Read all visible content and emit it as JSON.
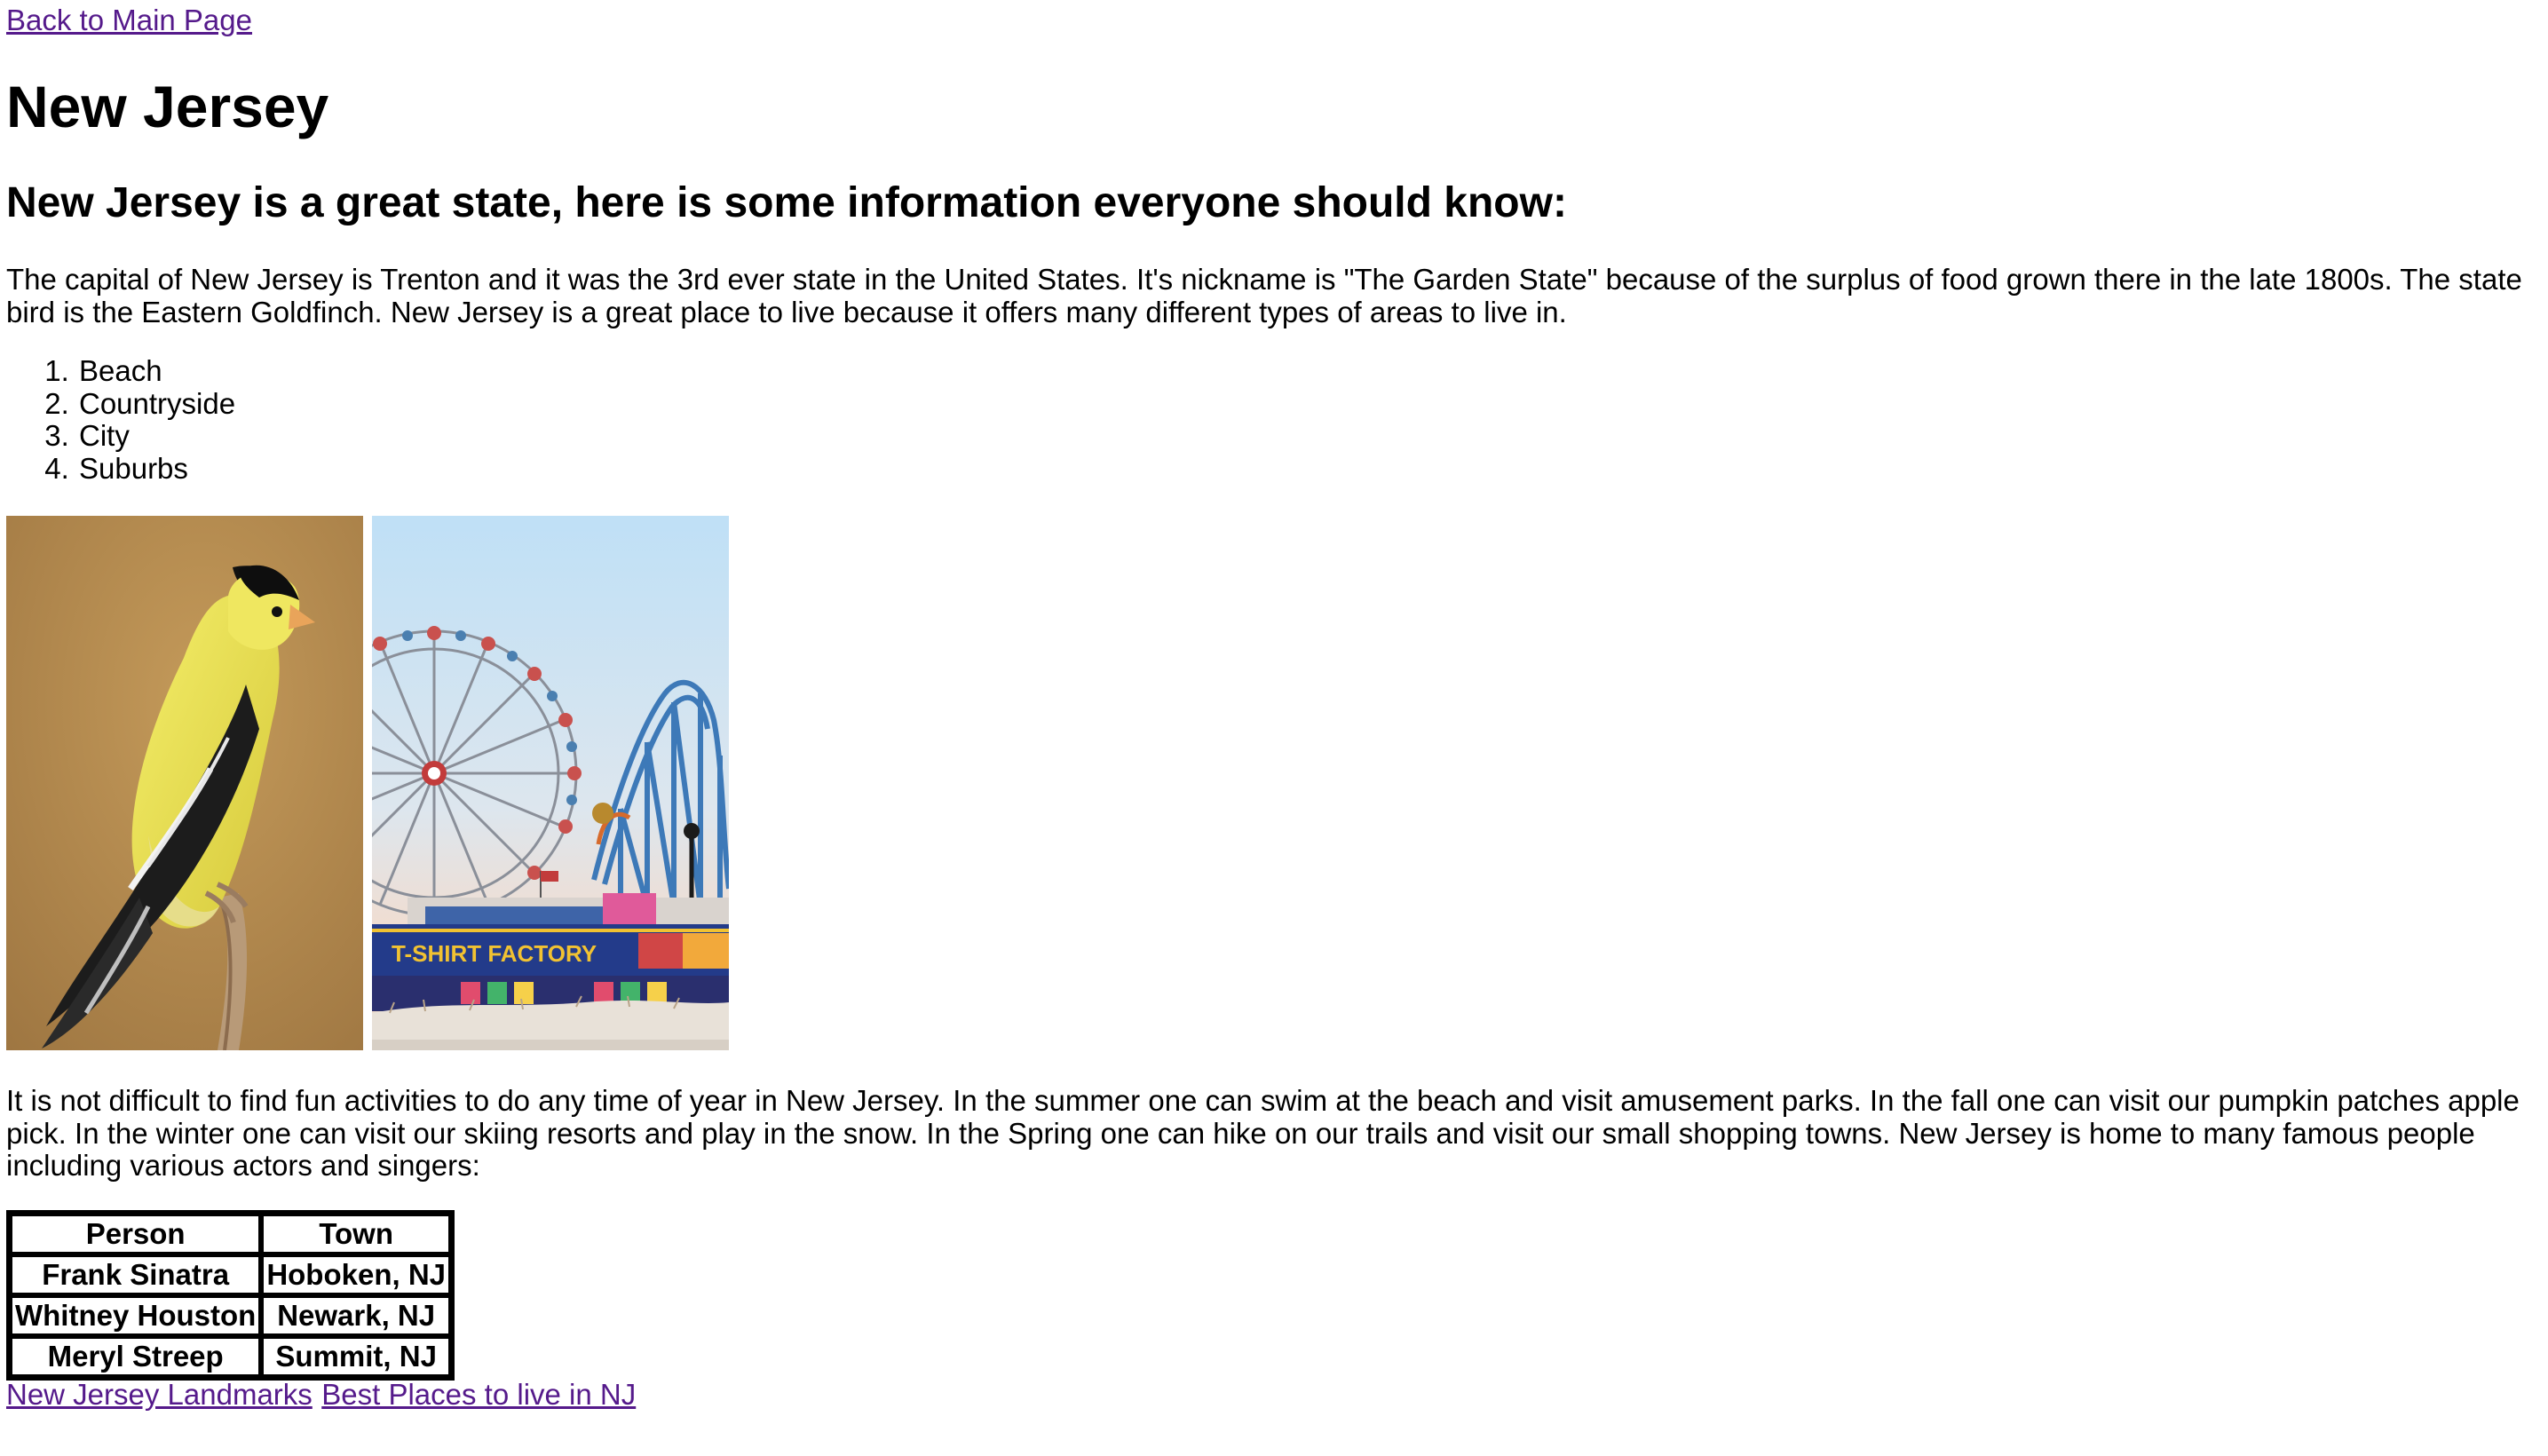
{
  "nav": {
    "back_link": "Back to Main Page"
  },
  "page": {
    "title": "New Jersey",
    "subheading": "New Jersey is a great state, here is some information everyone should know:",
    "intro": "The capital of New Jersey is Trenton and it was the 3rd ever state in the United States. It's nickname is \"The Garden State\" because of the surplus of food grown there in the late 1800s. The state bird is the Eastern Goldfinch. New Jersey is a great place to live because it offers many different types of areas to live in.",
    "areas": [
      "Beach",
      "Countryside",
      "City",
      "Suburbs"
    ],
    "activities": "It is not difficult to find fun activities to do any time of year in New Jersey. In the summer one can swim at the beach and visit amusement parks. In the fall one can visit our pumpkin patches apple pick. In the winter one can visit our skiing resorts and play in the snow. In the Spring one can hike on our trails and visit our small shopping towns. New Jersey is home to many famous people including various actors and singers:"
  },
  "images": {
    "boardwalk_sign": "T-SHIRT FACTORY"
  },
  "table": {
    "headers": [
      "Person",
      "Town"
    ],
    "rows": [
      [
        "Frank Sinatra",
        "Hoboken, NJ"
      ],
      [
        "Whitney Houston",
        "Newark, NJ"
      ],
      [
        "Meryl Streep",
        "Summit, NJ"
      ]
    ]
  },
  "footer": {
    "links": [
      "New Jersey Landmarks",
      "Best Places to live in NJ"
    ]
  },
  "colors": {
    "link": "#551a8b",
    "text": "#000000",
    "background": "#ffffff"
  }
}
